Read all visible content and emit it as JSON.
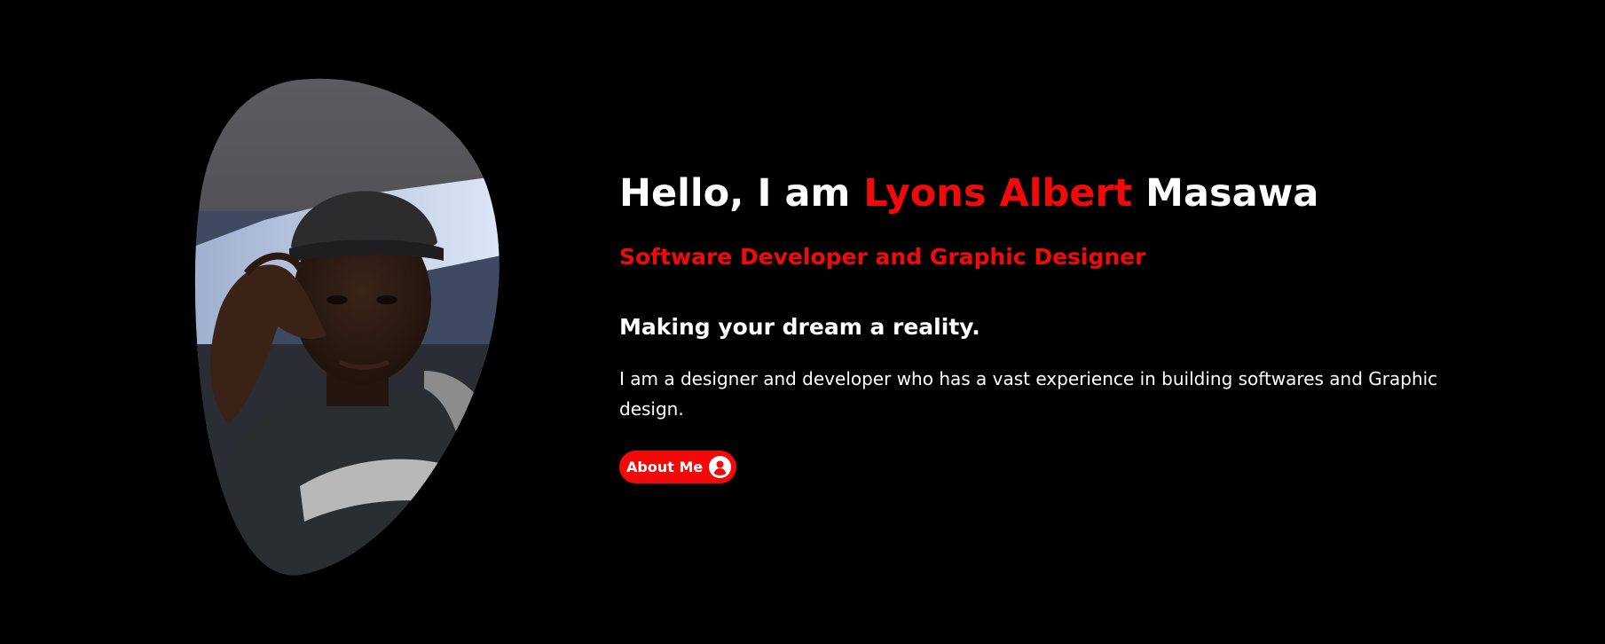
{
  "hero": {
    "greeting_prefix": "Hello, I am ",
    "name_first": "Lyons Albert",
    "name_last": " Masawa",
    "role": "Software Developer and Graphic Designer",
    "tagline": "Making your dream a reality.",
    "bio": "I am a designer and developer who has a vast experience in building softwares and Graphic design.",
    "about_button_label": "About Me",
    "about_button_icon": "user-circle-icon",
    "portrait": "profile-photo"
  },
  "colors": {
    "background": "#000000",
    "accent": "#f20a0a",
    "text": "#ffffff"
  }
}
